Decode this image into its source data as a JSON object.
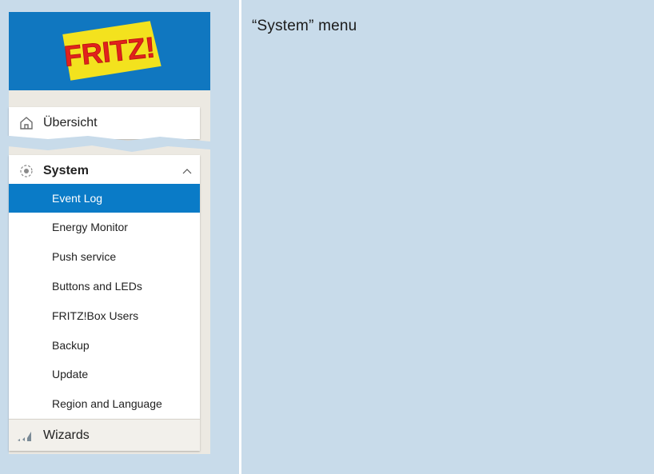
{
  "caption": "“System” menu",
  "logo": {
    "text": "FRITZ!"
  },
  "menu": {
    "overview": {
      "label": "Übersicht",
      "icon": "home-icon"
    },
    "system": {
      "label": "System",
      "icon": "system-icon",
      "expanded": true
    },
    "system_items": [
      {
        "label": "Event Log",
        "active": true
      },
      {
        "label": "Energy Monitor"
      },
      {
        "label": "Push service"
      },
      {
        "label": "Buttons and LEDs"
      },
      {
        "label": "FRITZ!Box Users"
      },
      {
        "label": "Backup"
      },
      {
        "label": "Update"
      },
      {
        "label": "Region and Language"
      }
    ],
    "wizards": {
      "label": "Wizards",
      "icon": "wizard-icon"
    }
  },
  "colors": {
    "header_blue": "#1077c0",
    "active_blue": "#0a7bc7",
    "background": "#c8dbea",
    "logo_yellow": "#f3e21e",
    "logo_red": "#e2211c"
  }
}
